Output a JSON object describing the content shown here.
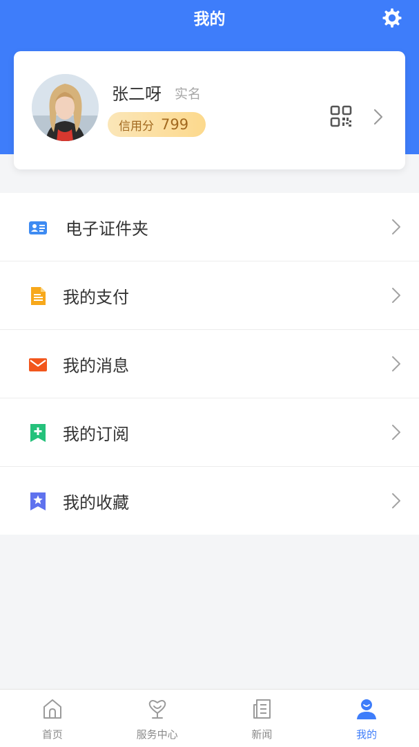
{
  "header": {
    "title": "我的",
    "settings_icon": "gear-icon",
    "background_color": "#3e7dfa"
  },
  "profile": {
    "name": "张二呀",
    "verified_label": "实名",
    "credit_label": "信用分",
    "credit_score": "799",
    "qr_icon": "qr-code-icon",
    "arrow_icon": "chevron-right-icon"
  },
  "menu": {
    "items": [
      {
        "label": "电子证件夹",
        "icon": "id-card-icon",
        "color": "#3e8bf2"
      },
      {
        "label": "我的支付",
        "icon": "document-icon",
        "color": "#f7a81b"
      },
      {
        "label": "我的消息",
        "icon": "envelope-icon",
        "color": "#f2561c"
      },
      {
        "label": "我的订阅",
        "icon": "bookmark-plus-icon",
        "color": "#25c17b"
      },
      {
        "label": "我的收藏",
        "icon": "bookmark-star-icon",
        "color": "#5f72ee"
      }
    ]
  },
  "tabbar": {
    "tabs": [
      {
        "label": "首页",
        "icon": "home-icon",
        "active": false
      },
      {
        "label": "服务中心",
        "icon": "heart-trophy-icon",
        "active": false
      },
      {
        "label": "新闻",
        "icon": "news-icon",
        "active": false
      },
      {
        "label": "我的",
        "icon": "user-icon",
        "active": true
      }
    ],
    "active_color": "#3e7dfa",
    "inactive_color": "#8a8a8a"
  }
}
